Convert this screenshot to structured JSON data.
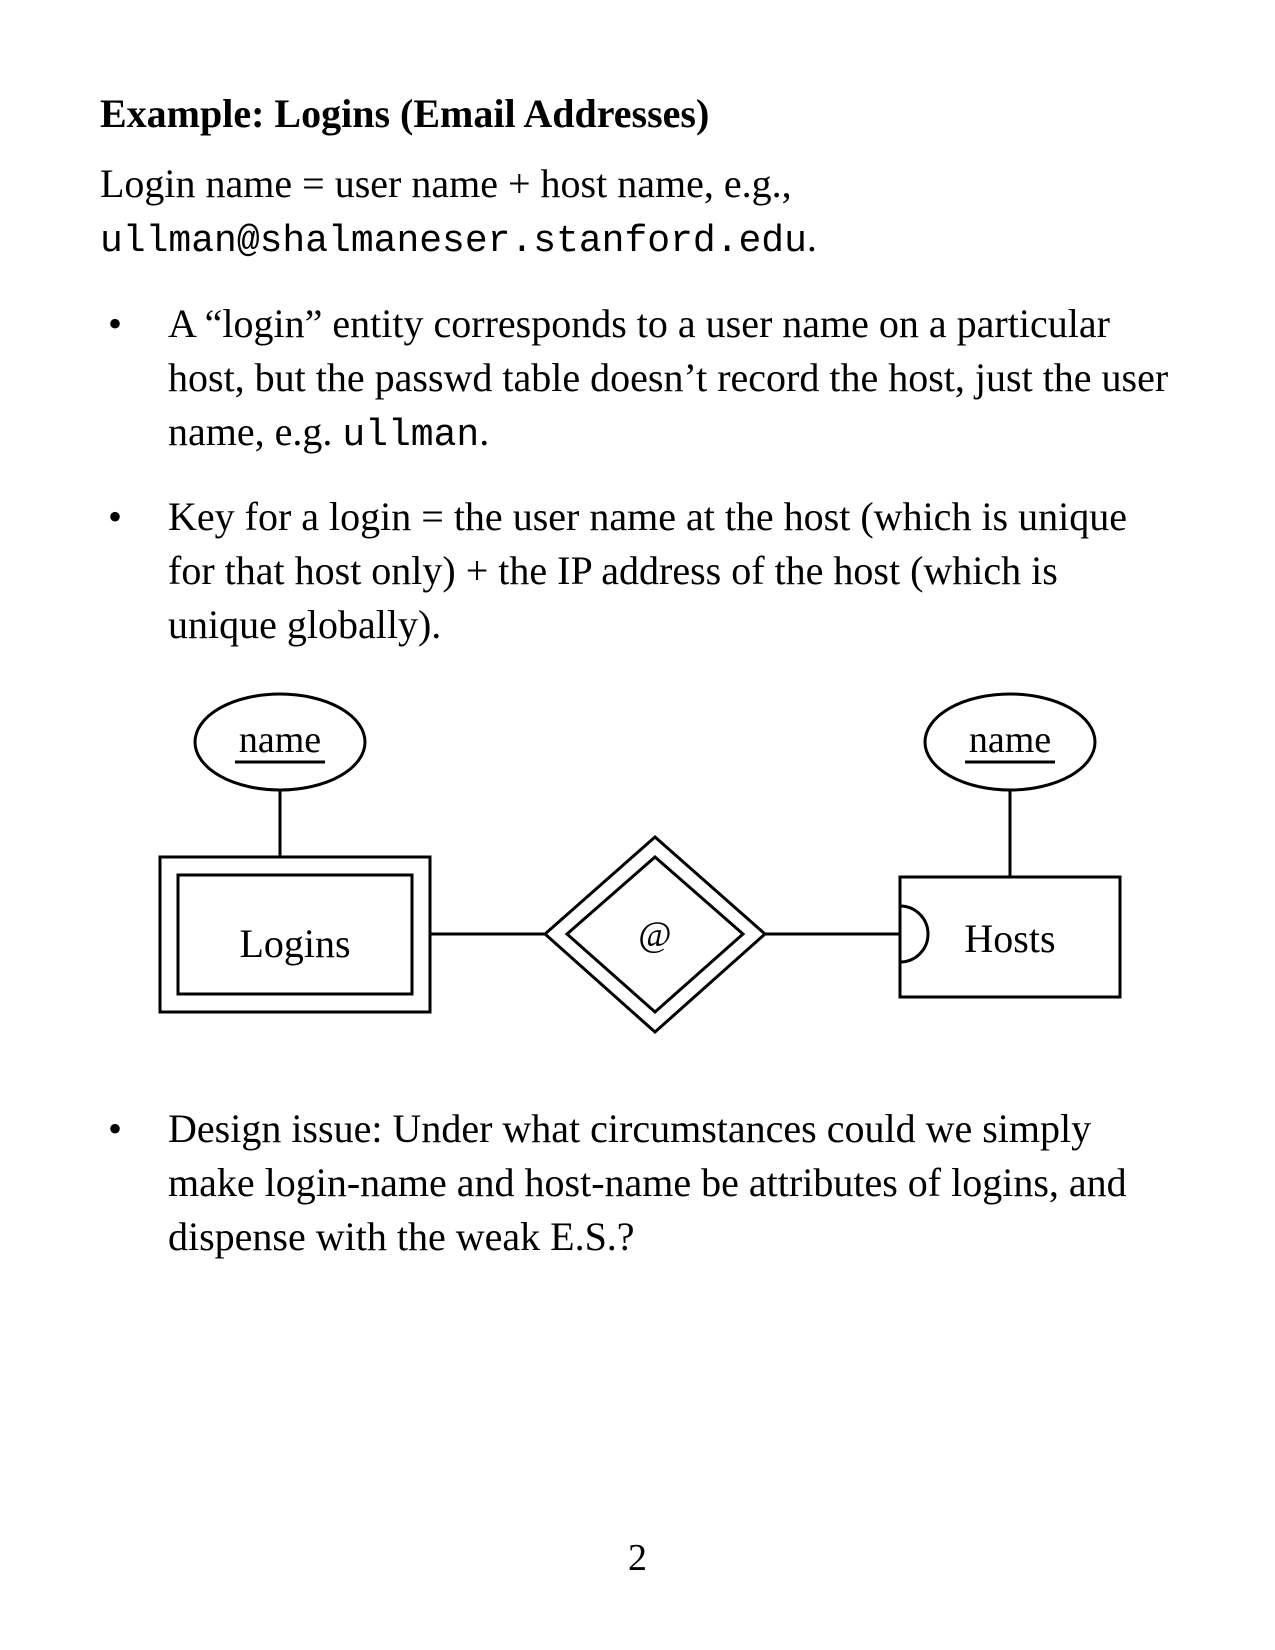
{
  "title": "Example: Logins (Email Addresses)",
  "intro_line1": "Login name = user name + host name, e.g.,",
  "intro_email": "ullman@shalmaneser.stanford.edu",
  "intro_period": ".",
  "bullet1_a": "A “login” entity corresponds to a user name on a particular host, but the passwd table doesn’t record the host, just the user name, e.g. ",
  "bullet1_mono": "ullman",
  "bullet1_b": ".",
  "bullet2": "Key for a login = the user name at the host (which is unique for that host only) + the IP address of the host (which is unique globally).",
  "bullet3": "Design issue: Under what circumstances could we simply make login-name and host-name be attributes of logins, and dispense with the weak E.S.?",
  "diagram": {
    "attr_left": "name",
    "attr_right": "name",
    "entity_left": "Logins",
    "entity_right": "Hosts",
    "relationship": "@"
  },
  "page_number": "2"
}
